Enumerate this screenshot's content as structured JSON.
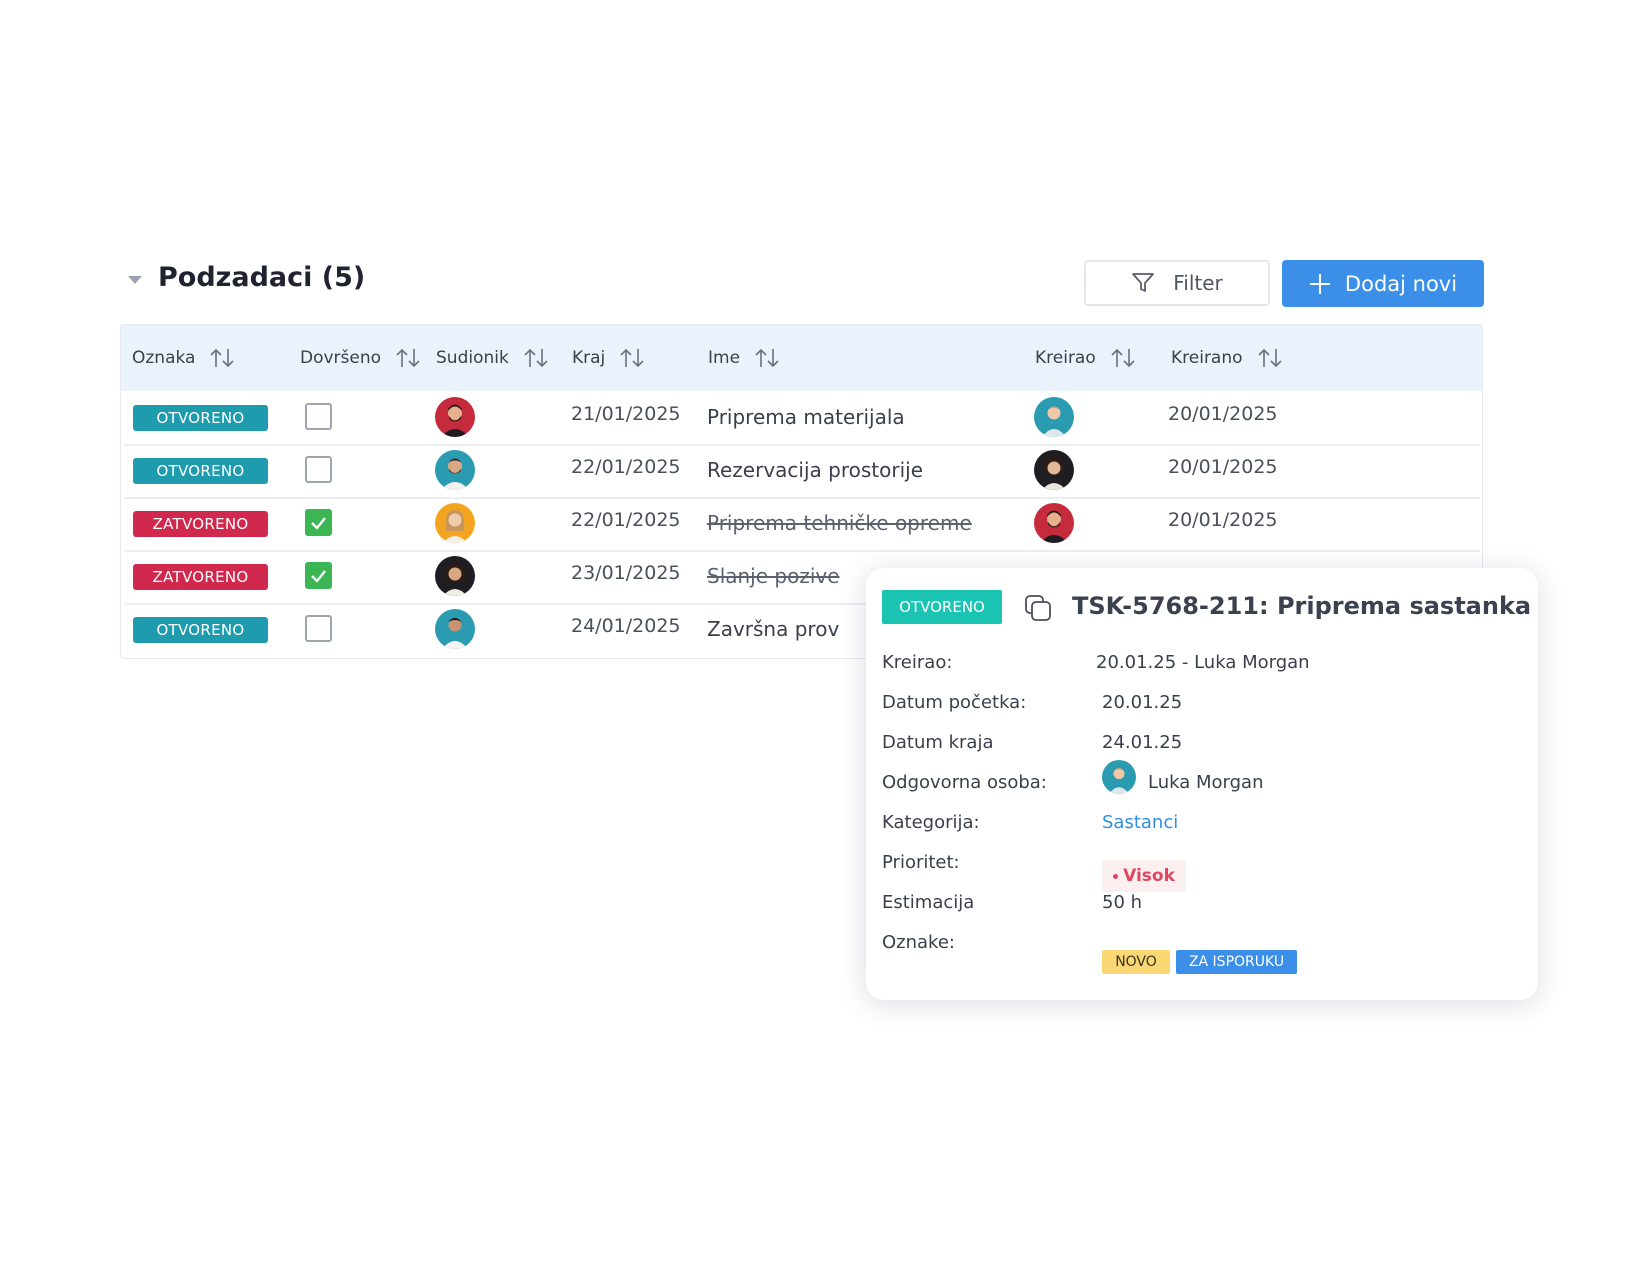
{
  "header": {
    "title": "Podzadaci (5)",
    "filter_label": "Filter",
    "add_label": "Dodaj novi"
  },
  "table": {
    "columns": [
      "Oznaka",
      "Dovršeno",
      "Sudionik",
      "Kraj",
      "Ime",
      "Kreirao",
      "Kreirano"
    ],
    "rows": [
      {
        "status": "OTVORENO",
        "done": false,
        "end": "21/01/2025",
        "name": "Priprema materijala",
        "created": "20/01/2025"
      },
      {
        "status": "OTVORENO",
        "done": false,
        "end": "22/01/2025",
        "name": "Rezervacija prostorije",
        "created": "20/01/2025"
      },
      {
        "status": "ZATVORENO",
        "done": true,
        "end": "22/01/2025",
        "name": "Priprema tehničke opreme",
        "created": "20/01/2025"
      },
      {
        "status": "ZATVORENO",
        "done": true,
        "end": "23/01/2025",
        "name": "Slanje pozive",
        "created": ""
      },
      {
        "status": "OTVORENO",
        "done": false,
        "end": "24/01/2025",
        "name": "Završna prov",
        "created": ""
      }
    ]
  },
  "popup": {
    "status": "OTVORENO",
    "title": "TSK-5768-211: Priprema sastanka",
    "fields": {
      "created_by_label": "Kreirao:",
      "created_by_value": "20.01.25 - Luka Morgan",
      "start_label": "Datum početka:",
      "start_value": "20.01.25",
      "end_label": "Datum kraja",
      "end_value": "24.01.25",
      "owner_label": "Odgovorna osoba:",
      "owner_value": "Luka Morgan",
      "category_label": "Kategorija:",
      "category_value": "Sastanci",
      "priority_label": "Prioritet:",
      "priority_value": "Visok",
      "estimate_label": "Estimacija",
      "estimate_value": "50 h",
      "tags_label": "Oznake:",
      "tags": [
        "NOVO",
        "ZA ISPORUKU"
      ]
    }
  },
  "colors": {
    "accent": "#3b8fe8",
    "open": "#1f9bae",
    "closed": "#d1284d",
    "done": "#3cb554",
    "popup_open": "#1bc3b3",
    "priority_high": "#e0475e"
  }
}
